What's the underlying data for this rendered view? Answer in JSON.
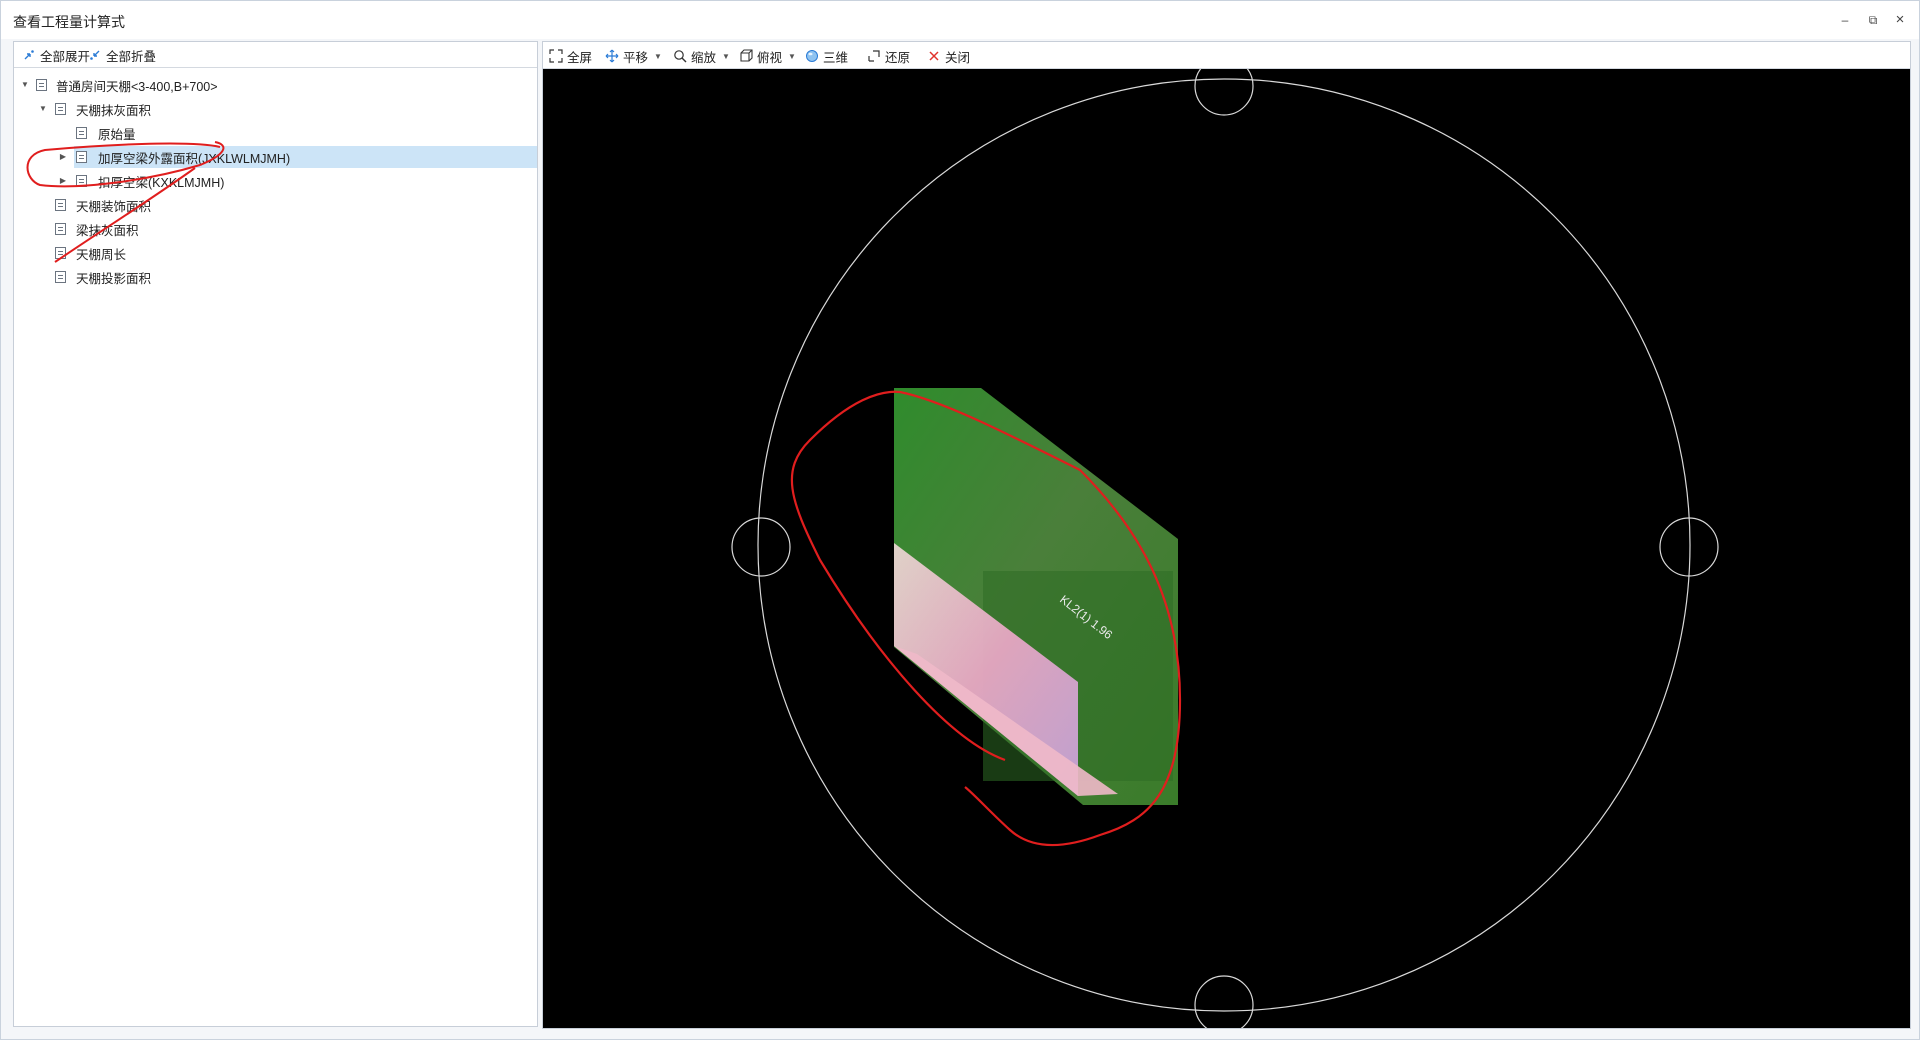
{
  "window": {
    "title": "查看工程量计算式",
    "controls": {
      "minimize": "–",
      "restore": "⧉",
      "close": "×"
    }
  },
  "left_toolbar": {
    "expand_all": "全部展开",
    "collapse_all": "全部折叠"
  },
  "tree": {
    "items": [
      {
        "label": "普通房间天棚<3-400,B+700>",
        "twisty": "▼"
      },
      {
        "label": "天棚抹灰面积",
        "twisty": "▼"
      },
      {
        "label": "原始量",
        "twisty": ""
      },
      {
        "label": "加厚空梁外露面积(JXKLWLMJMH)",
        "twisty": "▶"
      },
      {
        "label": "扣厚空梁(KXKLMJMH)",
        "twisty": "▶"
      },
      {
        "label": "天棚装饰面积",
        "twisty": ""
      },
      {
        "label": "梁抹灰面积",
        "twisty": ""
      },
      {
        "label": "天棚周长",
        "twisty": ""
      },
      {
        "label": "天棚投影面积",
        "twisty": ""
      }
    ]
  },
  "right_toolbar": {
    "fullscreen": "全屏",
    "pan": "平移",
    "zoom": "缩放",
    "view": "俯视",
    "three_d": "三维",
    "restore": "还原",
    "close": "关闭"
  },
  "viewport": {
    "beam_label": "KL2(1) 1.96",
    "colors": {
      "background": "#000000",
      "circle": "#d9d9d9",
      "beam_green": "#3f8a2a",
      "highlight_pink": "#e9b7c9",
      "annotation_red": "#e01e1e"
    }
  }
}
